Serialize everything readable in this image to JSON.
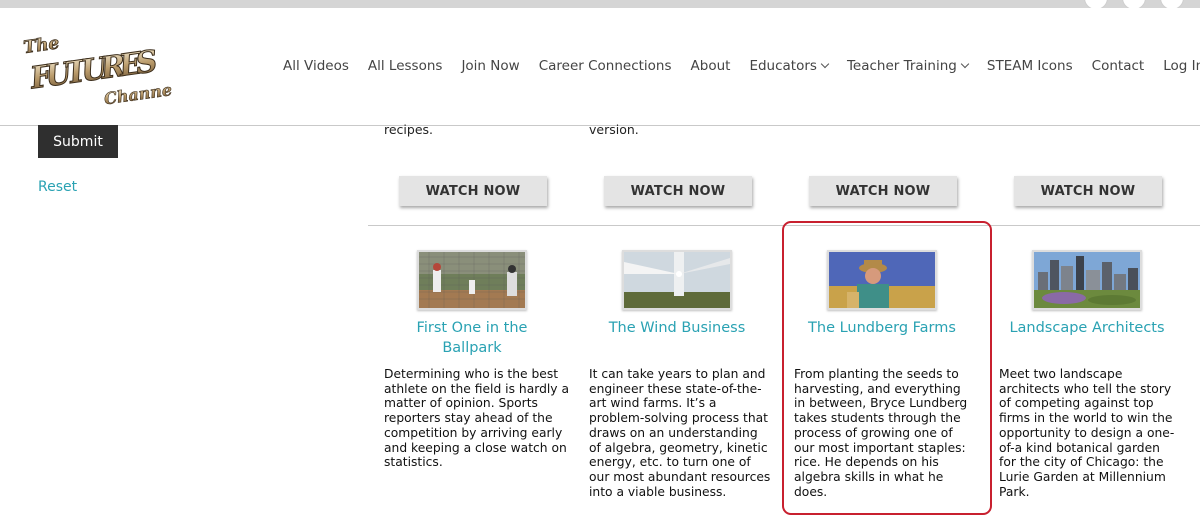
{
  "logo": {
    "line1": "The",
    "line2": "FUTURES",
    "line3": "Channel"
  },
  "nav": [
    {
      "label": "All Videos",
      "dropdown": false
    },
    {
      "label": "All Lessons",
      "dropdown": false
    },
    {
      "label": "Join Now",
      "dropdown": false
    },
    {
      "label": "Career Connections",
      "dropdown": false
    },
    {
      "label": "About",
      "dropdown": false
    },
    {
      "label": "Educators",
      "dropdown": true
    },
    {
      "label": "Teacher Training",
      "dropdown": true
    },
    {
      "label": "STEAM Icons",
      "dropdown": false
    },
    {
      "label": "Contact",
      "dropdown": false
    },
    {
      "label": "Log In",
      "dropdown": false
    }
  ],
  "sidebar": {
    "submit_label": "Submit",
    "reset_label": "Reset"
  },
  "prev_row": {
    "partial_texts": [
      "recipes.",
      "version."
    ],
    "watch_label": "WATCH NOW"
  },
  "cards": [
    {
      "title_line1": "First One in the",
      "title_line2": "Ballpark",
      "description": "Determining who is the best athlete on the field is hardly a matter of opinion. Sports reporters stay ahead of the competition by arriving early and keeping a close watch on statistics."
    },
    {
      "title_line1": "The Wind Business",
      "title_line2": "",
      "description": "It can take years to plan and engineer these state-of-the-art wind farms. It’s a problem-solving process that draws on an understanding of algebra, geometry, kinetic energy, etc. to turn one of our most abundant resources into a viable business."
    },
    {
      "title_line1": "The Lundberg Farms",
      "title_line2": "",
      "description": "From planting the seeds to harvesting, and everything in between, Bryce Lundberg takes students through the process of growing one of our most important staples: rice. He depends on his algebra skills in what he does."
    },
    {
      "title_line1": "Landscape Architects",
      "title_line2": "",
      "description": "Meet two landscape architects who tell the story of competing against top firms in the world to win the opportunity to design a one-of-a kind botanical garden for the city of Chicago: the Lurie Garden at Millennium Park."
    }
  ],
  "colors": {
    "accent": "#2aa2b3",
    "highlight": "#c8202f",
    "button_dark": "#2f2f2f"
  }
}
